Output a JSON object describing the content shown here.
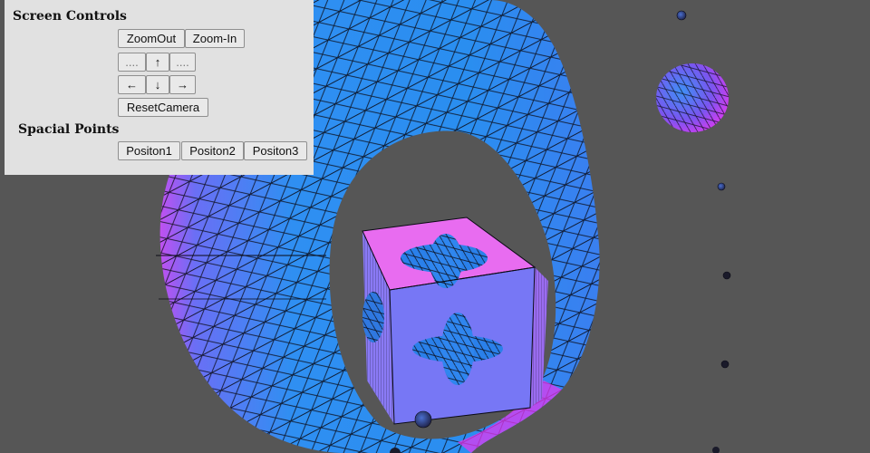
{
  "panel": {
    "screen_controls_title": "Screen Controls",
    "zoom_out_label": "ZoomOut",
    "zoom_in_label": "Zoom-In",
    "placeholder_left_label": "....",
    "up_label": "↑",
    "placeholder_right_label": "....",
    "left_label": "←",
    "down_label": "↓",
    "right_label": "→",
    "reset_camera_label": "ResetCamera",
    "spacial_points_title": "Spacial Points",
    "position1_label": "Positon1",
    "position2_label": "Positon2",
    "position3_label": "Positon3"
  },
  "colors": {
    "background": "#565656",
    "panel_background": "#e1e1e1",
    "mesh_blue": "#2a8ff0",
    "mesh_magenta": "#e93cf0",
    "mesh_violet": "#7a7cf5",
    "wireframe": "#0a0a14"
  }
}
